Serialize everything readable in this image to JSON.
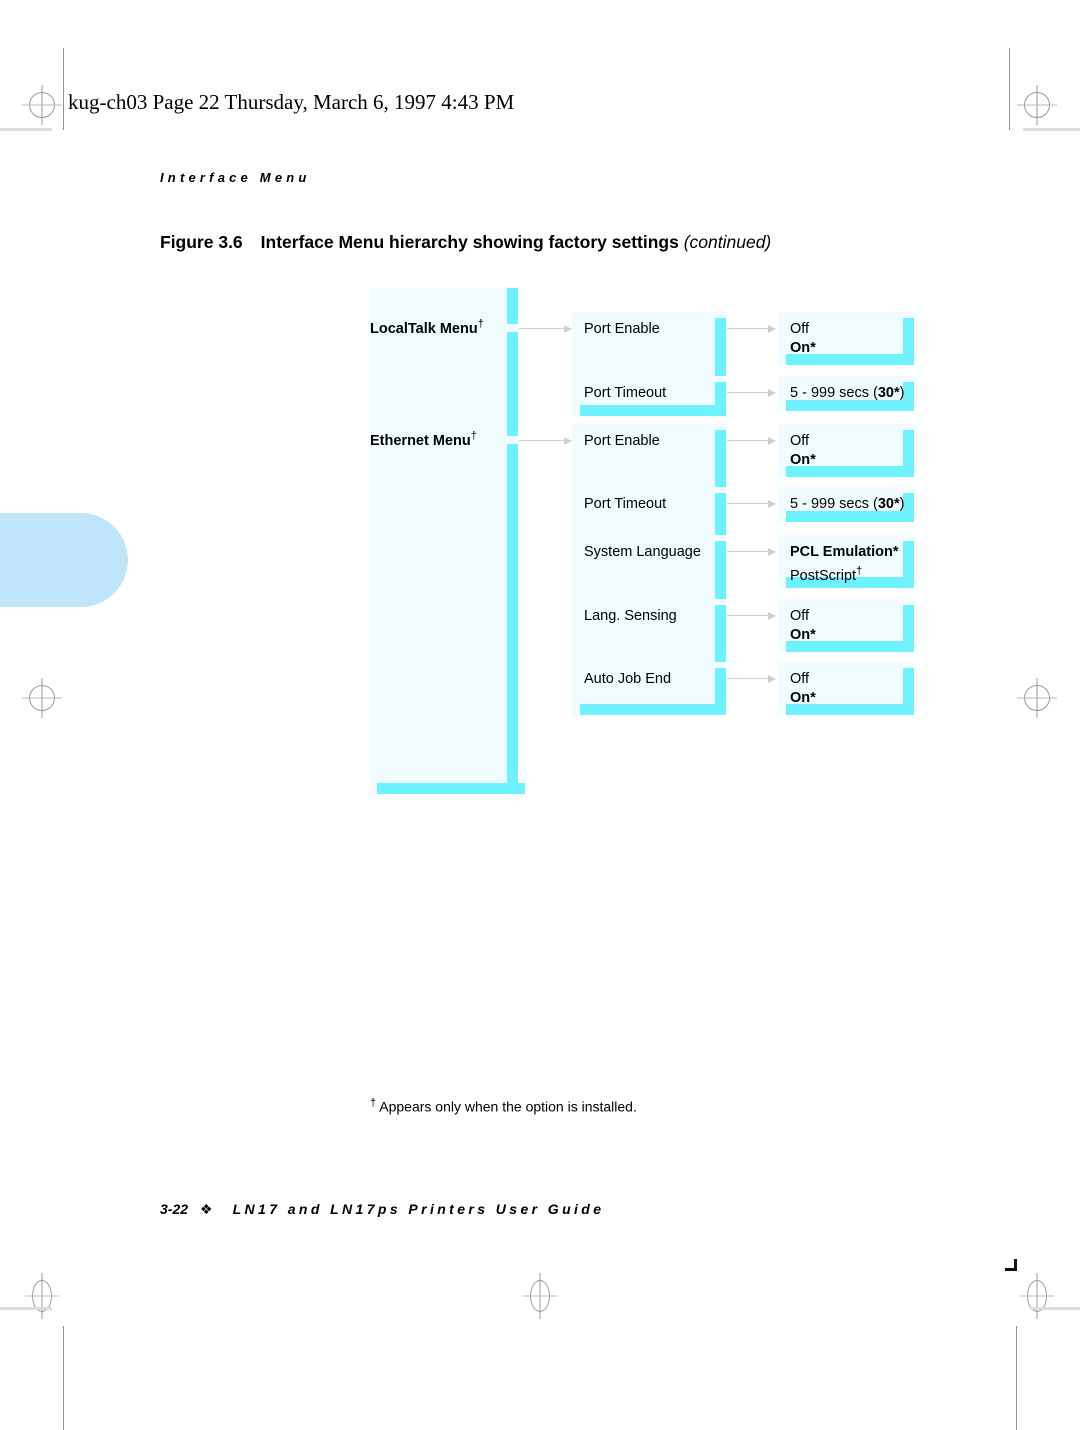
{
  "page": {
    "file_stamp": "kug-ch03  Page 22  Thursday, March 6, 1997  4:43 PM",
    "running_head": "Interface Menu",
    "figure": {
      "number": "Figure 3.6",
      "title": "Interface Menu hierarchy showing factory settings",
      "continued": "(continued)"
    },
    "footnote": "Appears only when the option is installed.",
    "footnote_marker": "†",
    "footer": {
      "page_number": "3-22",
      "diamond": "❖",
      "book_title": "LN17 and LN17ps Printers User Guide"
    }
  },
  "colors": {
    "box_fill": "#f0fcff",
    "box_edge": "#6ff2ff",
    "thumb_tab": "#bfe5fb",
    "connector": "#cfcfcf",
    "text": "#000000"
  },
  "diagram": {
    "menus": [
      {
        "label": "LocalTalk Menu",
        "dagger": "†"
      },
      {
        "label": "Ethernet Menu",
        "dagger": "†"
      }
    ],
    "items": [
      {
        "name": "Port Enable",
        "menu": "LocalTalk Menu",
        "values_html": "Off<br><b>On*</b>",
        "values_text": "Off / On*"
      },
      {
        "name": "Port Timeout",
        "menu": "LocalTalk Menu",
        "values_html": "5 - 999 secs (<b>30*</b>)",
        "values_text": "5 - 999 secs (30*)"
      },
      {
        "name": "Port Enable",
        "menu": "Ethernet Menu",
        "values_html": "Off<br><b>On*</b>",
        "values_text": "Off / On*"
      },
      {
        "name": "Port Timeout",
        "menu": "Ethernet Menu",
        "values_html": "5 - 999 secs (<b>30*</b>)",
        "values_text": "5 - 999 secs (30*)"
      },
      {
        "name": "System Language",
        "menu": "Ethernet Menu",
        "values_html": "<b>PCL Emulation*</b><br>PostScript<sup>†</sup>",
        "values_text": "PCL Emulation* / PostScript†"
      },
      {
        "name": "Lang. Sensing",
        "menu": "Ethernet Menu",
        "values_html": "Off<br><b>On*</b>",
        "values_text": "Off / On*"
      },
      {
        "name": "Auto Job End",
        "menu": "Ethernet Menu",
        "values_html": "Off<br><b>On*</b>",
        "values_text": "Off / On*"
      }
    ]
  }
}
